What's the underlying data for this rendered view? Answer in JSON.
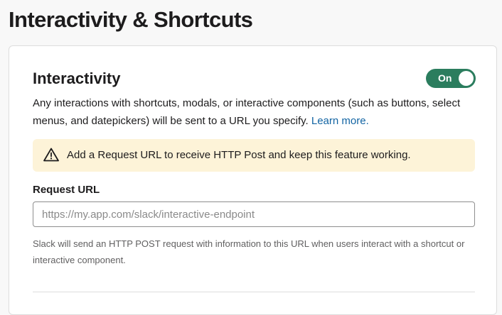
{
  "page": {
    "title": "Interactivity & Shortcuts"
  },
  "interactivity": {
    "heading": "Interactivity",
    "toggle_label": "On",
    "toggle_state": "on",
    "description": "Any interactions with shortcuts, modals, or interactive components (such as buttons, select menus, and datepickers) will be sent to a URL you specify.",
    "learn_more_label": "Learn more.",
    "warning": {
      "icon": "warning-triangle-icon",
      "text": "Add a Request URL to receive HTTP Post and keep this feature working."
    },
    "request_url": {
      "label": "Request URL",
      "value": "",
      "placeholder": "https://my.app.com/slack/interactive-endpoint",
      "help_text": "Slack will send an HTTP POST request with information to this URL when users interact with a shortcut or interactive component."
    }
  },
  "colors": {
    "toggle_on": "#2b7d5e",
    "link": "#1264a3",
    "warning_background": "#fdf3d8"
  }
}
